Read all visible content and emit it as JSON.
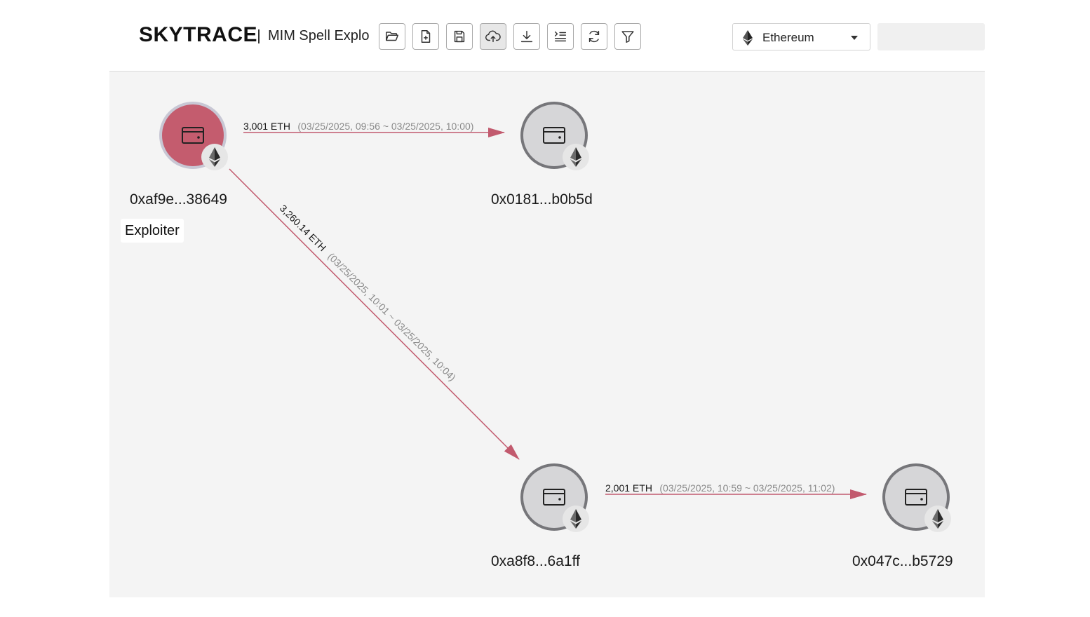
{
  "header": {
    "brand": "SKYTRACE",
    "case_title": "MIM Spell Explo"
  },
  "toolbar": {
    "buttons": [
      {
        "icon": "folder-open-icon",
        "name": "open-button"
      },
      {
        "icon": "file-plus-icon",
        "name": "new-button"
      },
      {
        "icon": "save-icon",
        "name": "save-button"
      },
      {
        "icon": "cloud-upload-icon",
        "name": "upload-button",
        "active": true
      },
      {
        "icon": "download-icon",
        "name": "download-button"
      },
      {
        "icon": "list-indent-icon",
        "name": "list-button"
      },
      {
        "icon": "refresh-icon",
        "name": "refresh-button"
      },
      {
        "icon": "filter-icon",
        "name": "filter-button"
      }
    ]
  },
  "chain_select": {
    "selected": "Ethereum",
    "icon": "ethereum-icon"
  },
  "colors": {
    "edge": "#c25a6e",
    "exploiter_node": "#c45c6e",
    "node_fill": "#d6d6d8",
    "node_ring": "#76767a",
    "canvas_bg": "#f4f4f4"
  },
  "graph": {
    "nodes": [
      {
        "id": "n1",
        "address": "0xaf9e...38649",
        "tag": "Exploiter",
        "type": "exploiter"
      },
      {
        "id": "n2",
        "address": "0x0181...b0b5d",
        "type": "wallet"
      },
      {
        "id": "n3",
        "address": "0xa8f8...6a1ff",
        "type": "wallet"
      },
      {
        "id": "n4",
        "address": "0x047c...b5729",
        "type": "wallet"
      }
    ],
    "edges": [
      {
        "from": "n1",
        "to": "n2",
        "amount": "3,001 ETH",
        "time": "(03/25/2025, 09:56 ~ 03/25/2025, 10:00)"
      },
      {
        "from": "n1",
        "to": "n3",
        "amount": "3,260.14 ETH",
        "time": "(03/25/2025, 10:01 ~ 03/25/2025, 10:04)"
      },
      {
        "from": "n3",
        "to": "n4",
        "amount": "2,001 ETH",
        "time": "(03/25/2025, 10:59 ~ 03/25/2025, 11:02)"
      }
    ]
  }
}
